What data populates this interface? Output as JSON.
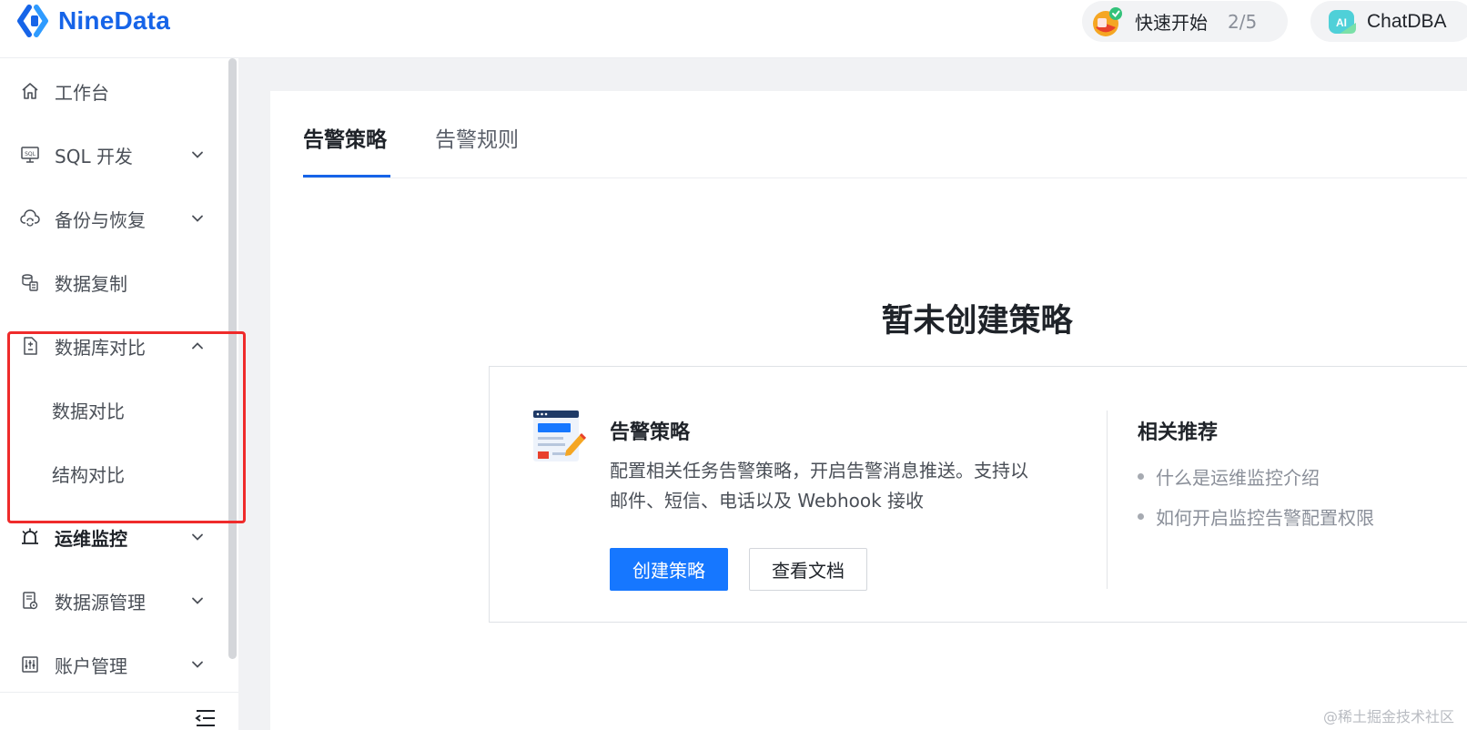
{
  "header": {
    "logo_text": "NineData",
    "quick_start": {
      "label": "快速开始",
      "progress": "2/5"
    },
    "chatdba": {
      "badge": "AI",
      "label": "ChatDBA"
    }
  },
  "sidebar": {
    "items": [
      {
        "label": "工作台",
        "icon": "home-icon"
      },
      {
        "label": "SQL 开发",
        "icon": "monitor-sql-icon",
        "expandable": true
      },
      {
        "label": "备份与恢复",
        "icon": "cloud-sync-icon",
        "expandable": true
      },
      {
        "label": "数据复制",
        "icon": "database-copy-icon"
      },
      {
        "label": "数据库对比",
        "icon": "document-compare-icon",
        "expanded": true,
        "children": [
          "数据对比",
          "结构对比"
        ]
      },
      {
        "label": "运维监控",
        "icon": "alarm-icon",
        "expandable": true,
        "active": true
      },
      {
        "label": "数据源管理",
        "icon": "datasource-icon",
        "expandable": true
      },
      {
        "label": "账户管理",
        "icon": "account-settings-icon",
        "expandable": true
      }
    ]
  },
  "main": {
    "tabs": [
      {
        "label": "告警策略",
        "active": true
      },
      {
        "label": "告警规则",
        "active": false
      }
    ],
    "empty_title": "暂未创建策略",
    "card": {
      "title": "告警策略",
      "description_line1": "配置相关任务告警策略，开启告警消息推送。支持以",
      "description_line2": "邮件、短信、电话以及 Webhook 接收",
      "primary_button": "创建策略",
      "secondary_button": "查看文档",
      "recommend_title": "相关推荐",
      "recommend_links": [
        "什么是运维监控介绍",
        "如何开启监控告警配置权限"
      ]
    }
  },
  "watermark": "@稀土掘金技术社区",
  "colors": {
    "brand_blue": "#1664e8",
    "primary_button": "#1677ff",
    "highlight_red": "#ef2b2b"
  }
}
